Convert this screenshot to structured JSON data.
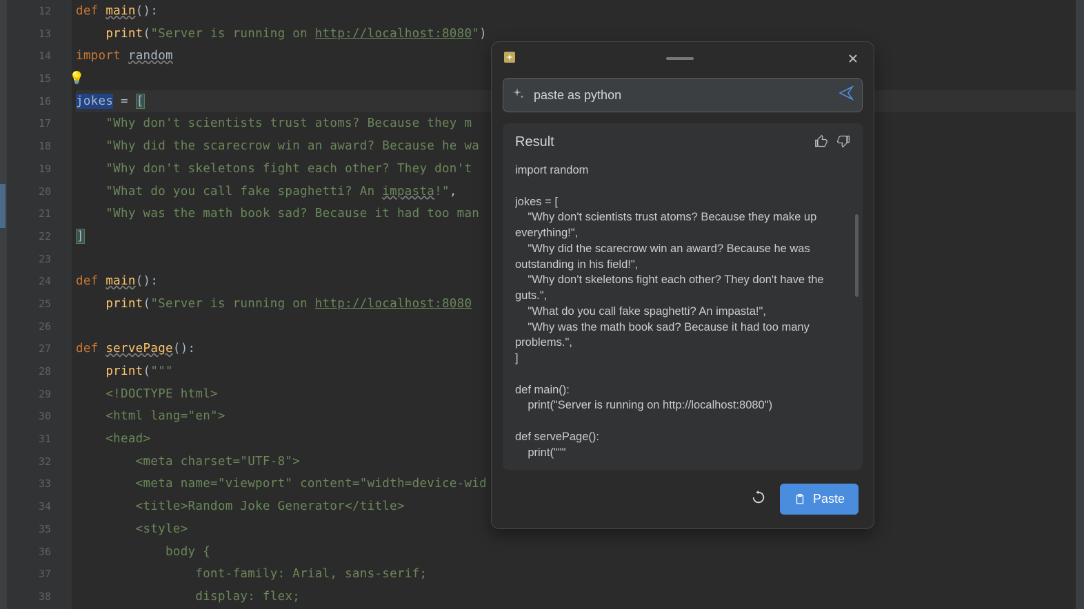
{
  "gutter": {
    "start": 12,
    "end": 38
  },
  "code": {
    "line12": "def main():",
    "line13": "    print(\"Server is running on http://localhost:8080\")",
    "line14": "import random",
    "line15": "",
    "line16": "jokes = [",
    "line17": "    \"Why don't scientists trust atoms? Because they m",
    "line18": "    \"Why did the scarecrow win an award? Because he wa",
    "line19": "    \"Why don't skeletons fight each other? They don't",
    "line20": "    \"What do you call fake spaghetti? An impasta!\",",
    "line21": "    \"Why was the math book sad? Because it had too man",
    "line22": "]",
    "line23": "",
    "line24": "def main():",
    "line25": "    print(\"Server is running on http://localhost:8080",
    "line26": "",
    "line27": "def servePage():",
    "line28": "    print(\"\"\"",
    "line29": "    <!DOCTYPE html>",
    "line30": "    <html lang=\"en\">",
    "line31": "    <head>",
    "line32": "        <meta charset=\"UTF-8\">",
    "line33": "        <meta name=\"viewport\" content=\"width=device-wid",
    "line34": "        <title>Random Joke Generator</title>",
    "line35": "        <style>",
    "line36": "            body {",
    "line37": "                font-family: Arial, sans-serif;",
    "line38": "                display: flex;"
  },
  "popup": {
    "prompt_value": "paste as python",
    "result_title": "Result",
    "result_text": "import random\n\njokes = [\n    \"Why don't scientists trust atoms? Because they make up everything!\",\n    \"Why did the scarecrow win an award? Because he was outstanding in his field!\",\n    \"Why don't skeletons fight each other? They don't have the guts.\",\n    \"What do you call fake spaghetti? An impasta!\",\n    \"Why was the math book sad? Because it had too many problems.\",\n]\n\ndef main():\n    print(\"Server is running on http://localhost:8080\")\n\ndef servePage():\n    print(\"\"\"\n    <!DOCTYPE html>",
    "paste_label": "Paste"
  }
}
